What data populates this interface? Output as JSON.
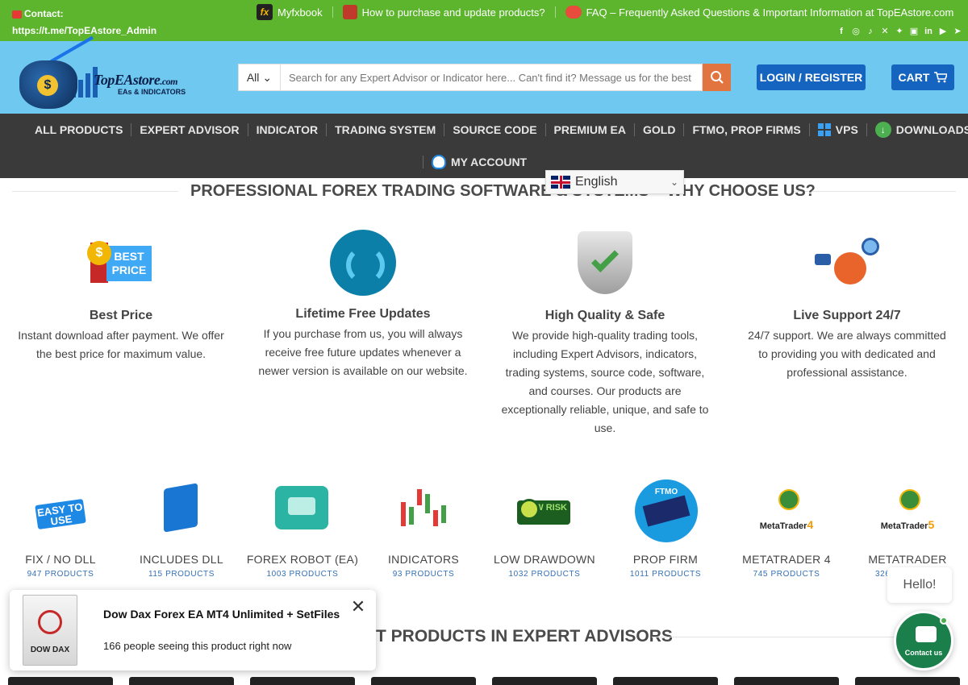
{
  "topbar": {
    "contact_label": "Contact:",
    "contact_value": "https://t.me/TopEAstore_Admin",
    "links": [
      {
        "label": "Myfxbook"
      },
      {
        "label": "How to purchase and update products?"
      },
      {
        "label": "FAQ – Frequently Asked Questions & Important Information at TopEAstore.com"
      }
    ],
    "social_icons": [
      "facebook-icon",
      "instagram-icon",
      "tiktok-icon",
      "x-icon",
      "twitter-icon",
      "youtube-icon",
      "linkedin-icon",
      "youtube-play-icon",
      "telegram-icon"
    ]
  },
  "header": {
    "logo_name": "TopEAstore",
    "logo_domain": ".com",
    "logo_tagline": "EAs & INDICATORS",
    "search_category": "All",
    "search_placeholder": "Search for any Expert Advisor or Indicator here... Can't find it? Message us for the best p",
    "login_label": "LOGIN / REGISTER",
    "cart_label": "CART"
  },
  "nav": {
    "items": [
      {
        "label": "ALL PRODUCTS"
      },
      {
        "label": "EXPERT ADVISOR"
      },
      {
        "label": "INDICATOR"
      },
      {
        "label": "TRADING SYSTEM"
      },
      {
        "label": "SOURCE CODE"
      },
      {
        "label": "PREMIUM EA"
      },
      {
        "label": "GOLD"
      },
      {
        "label": "FTMO, PROP FIRMS"
      },
      {
        "label": "VPS"
      },
      {
        "label": "DOWNLOADS"
      },
      {
        "label": "MY ACCOUNT"
      }
    ]
  },
  "language": {
    "selected": "English"
  },
  "section_title": "PROFESSIONAL FOREX TRADING SOFTWARE & SYSTEMS – WHY CHOOSE US?",
  "features": [
    {
      "title": "Best Price",
      "text": "Instant download after payment. We offer the best price for maximum value.",
      "icon": "best-price-icon",
      "icon_text": "BEST PRICE"
    },
    {
      "title": "Lifetime Free Updates",
      "text": "If you purchase from us, you will always receive free future updates whenever a newer version is available on our website.",
      "icon": "refresh-icon"
    },
    {
      "title": "High Quality & Safe",
      "text": "We provide high-quality trading tools, including Expert Advisors, indicators, trading systems, source code, software, and courses. Our products are exceptionally reliable, unique, and safe to use.",
      "icon": "shield-check-icon"
    },
    {
      "title": "Live Support 24/7",
      "text": "24/7 support. We are always committed to providing you with dedicated and professional assistance.",
      "icon": "support-agent-icon"
    }
  ],
  "categories": [
    {
      "name": "FIX / NO DLL",
      "count": "947 PRODUCTS",
      "icon_text": "EASY TO USE"
    },
    {
      "name": "INCLUDES DLL",
      "count": "115 PRODUCTS"
    },
    {
      "name": "FOREX ROBOT (EA)",
      "count": "1003 PRODUCTS"
    },
    {
      "name": "INDICATORS",
      "count": "93 PRODUCTS"
    },
    {
      "name": "LOW DRAWDOWN",
      "count": "1032 PRODUCTS",
      "icon_text": "LOW RISK"
    },
    {
      "name": "PROP FIRM",
      "count": "1011 PRODUCTS",
      "icon_text": "FTMO"
    },
    {
      "name": "METATRADER 4",
      "count": "745 PRODUCTS",
      "icon_text": "MetaTrader",
      "icon_num": "4"
    },
    {
      "name": "METATRADER",
      "count": "326",
      "icon_text": "MetaTrader",
      "icon_num": "5"
    }
  ],
  "section2_title": "T PRODUCTS IN EXPERT ADVISORS",
  "popup": {
    "product_image_text": "DOW DAX",
    "title": "Dow Dax Forex EA MT4 Unlimited + SetFiles",
    "message": "166 people seeing this product right now"
  },
  "chat": {
    "hello": "Hello!",
    "label": "Contact us"
  },
  "colors": {
    "topbar": "#5cb52d",
    "header": "#6ec8ef",
    "nav": "#3a3a3a",
    "button": "#1565c0",
    "search_button": "#e2743f",
    "count_link": "#3470b5",
    "chat": "#1a7f4a"
  }
}
